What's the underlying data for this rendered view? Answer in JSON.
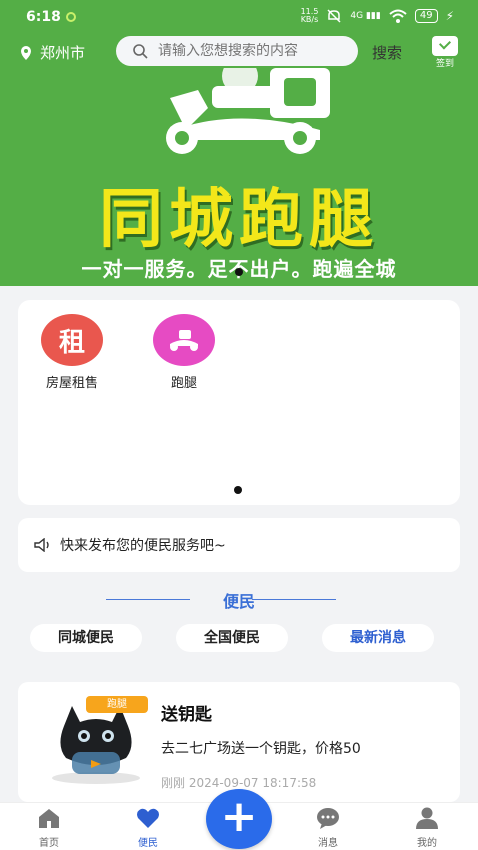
{
  "status_bar": {
    "time": "6:18",
    "net_speed_value": "11.5",
    "net_speed_unit": "KB/s",
    "signal_label": "4G",
    "battery": "49"
  },
  "header": {
    "location": "郑州市",
    "search_placeholder": "请输入您想搜索的内容",
    "search_button": "搜索",
    "signin_label": "签到"
  },
  "banner": {
    "title": "同城跑腿",
    "subtitle": "一对一服务。足不出户。跑遍全城",
    "bg_color": "#54ae46",
    "title_color": "#f3e71a"
  },
  "categories": [
    {
      "label": "房屋租售",
      "icon_text": "租",
      "icon": "rent-icon",
      "color": "#e9574e"
    },
    {
      "label": "跑腿",
      "icon": "scooter-icon",
      "color": "#e64bc3"
    }
  ],
  "notice": {
    "text": "快来发布您的便民服务吧~",
    "icon": "speaker-icon"
  },
  "section": {
    "title": "便民"
  },
  "tabs": [
    {
      "label": "同城便民",
      "active": false
    },
    {
      "label": "全国便民",
      "active": false
    },
    {
      "label": "最新消息",
      "active": true
    }
  ],
  "post": {
    "badge": "跑腿",
    "title": "送钥匙",
    "description": "去二七广场送一个钥匙，价格50",
    "time": "刚刚 2024-09-07 18:17:58"
  },
  "bottom_nav": [
    {
      "label": "首页",
      "icon": "home-icon",
      "active": false
    },
    {
      "label": "便民",
      "icon": "heart-icon",
      "active": true
    },
    {
      "label": "消息",
      "icon": "chat-icon",
      "active": false
    },
    {
      "label": "我的",
      "icon": "user-icon",
      "active": false
    }
  ],
  "fab_label": "+",
  "accent_color": "#2a6bea"
}
